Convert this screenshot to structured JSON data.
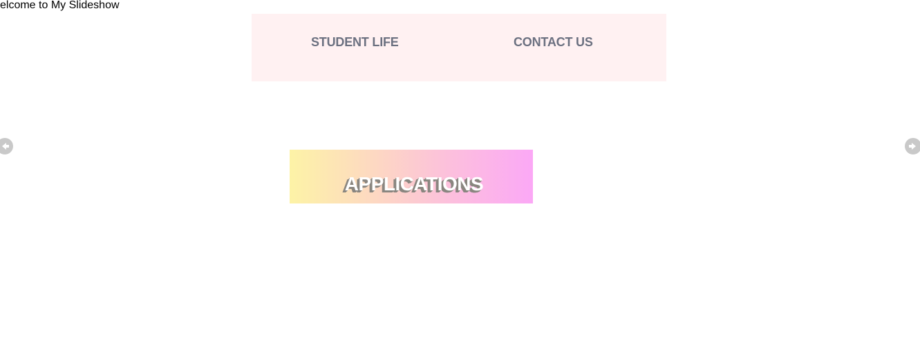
{
  "header": {
    "marquee_text": "elcome to My Slideshow"
  },
  "nav": {
    "items": [
      {
        "label": "STUDENT LIFE"
      },
      {
        "label": "CONTACT US"
      }
    ]
  },
  "slideshow": {
    "prev_icon": "arrow-left-circle-icon",
    "next_icon": "arrow-right-circle-icon",
    "slide_title": "APPLICATIONS"
  },
  "colors": {
    "nav_background": "#fff1f2",
    "nav_text": "#6b7080",
    "banner_gradient_start": "#fdf3a6",
    "banner_gradient_end": "#fba8f6",
    "arrow": "#c9c9c9"
  }
}
